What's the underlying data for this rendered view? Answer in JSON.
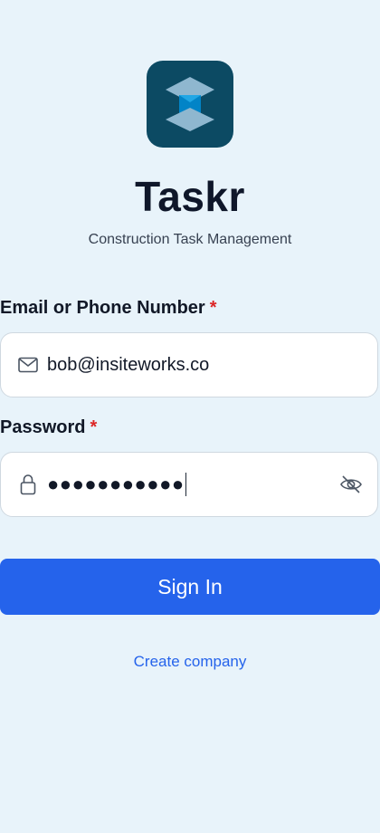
{
  "app": {
    "title": "Taskr",
    "subtitle": "Construction Task Management",
    "logo_icon": "stacked-layers-logo",
    "logo_bg": "#0c4a63"
  },
  "email_field": {
    "label": "Email or Phone Number",
    "required_marker": "*",
    "icon": "mail-icon",
    "value": "bob@insiteworks.co"
  },
  "password_field": {
    "label": "Password",
    "required_marker": "*",
    "icon": "lock-icon",
    "masked_value": "●●●●●●●●●●●",
    "toggle_icon": "eye-off-icon"
  },
  "actions": {
    "sign_in": "Sign In",
    "create_company": "Create company"
  },
  "colors": {
    "background": "#e8f3fa",
    "primary": "#2563eb",
    "required": "#dc2626",
    "title": "#0f172a"
  }
}
